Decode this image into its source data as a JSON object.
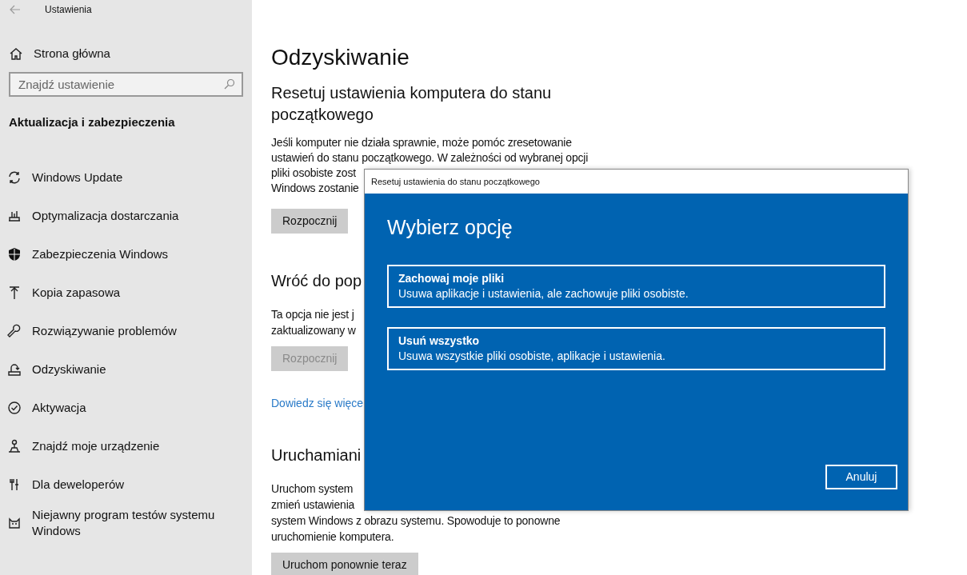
{
  "sidebar": {
    "app_title": "Ustawienia",
    "home": "Strona główna",
    "search": {
      "placeholder": "Znajdź ustawienie"
    },
    "section": "Aktualizacja i zabezpieczenia",
    "items": [
      {
        "label": "Windows Update",
        "selected": false
      },
      {
        "label": "Optymalizacja dostarczania",
        "selected": false
      },
      {
        "label": "Zabezpieczenia Windows",
        "selected": false
      },
      {
        "label": "Kopia zapasowa",
        "selected": false
      },
      {
        "label": "Rozwiązywanie problemów",
        "selected": false
      },
      {
        "label": "Odzyskiwanie",
        "selected": false
      },
      {
        "label": "Aktywacja",
        "selected": false
      },
      {
        "label": "Znajdź moje urządzenie",
        "selected": false
      },
      {
        "label": "Dla deweloperów",
        "selected": false
      },
      {
        "label": "Niejawny program testów systemu Windows",
        "selected": false
      }
    ]
  },
  "main": {
    "title": "Odzyskiwanie",
    "sections": [
      {
        "heading": [
          "Resetuj ustawienia komputera do stanu",
          "początkowego"
        ],
        "text": [
          "Jeśli komputer nie działa sprawnie, może pomóc zresetowanie",
          "ustawień do stanu początkowego. W zależności od wybranej opcji",
          "pliki osobiste zost",
          "Windows zostanie"
        ],
        "button": {
          "label": "Rozpocznij",
          "disabled": false
        }
      },
      {
        "heading": [
          "Wróć do pop"
        ],
        "text": [
          "Ta opcja nie jest j",
          "zaktualizowany w"
        ],
        "button": {
          "label": "Rozpocznij",
          "disabled": true
        },
        "link": "Dowiedz się więce"
      },
      {
        "heading": [
          "Uruchamiani"
        ],
        "text": [
          "Uruchom system",
          "zmień ustawienia",
          "system Windows z obrazu systemu. Spowoduje to ponowne",
          "uruchomienie komputera."
        ],
        "button": {
          "label": "Uruchom ponownie teraz",
          "disabled": false
        }
      }
    ]
  },
  "dialog": {
    "title": "Resetuj ustawienia do stanu początkowego",
    "heading": "Wybierz opcję",
    "options": [
      {
        "title": "Zachowaj moje pliki",
        "description": "Usuwa aplikacje i ustawienia, ale zachowuje pliki osobiste."
      },
      {
        "title": "Usuń wszystko",
        "description": "Usuwa wszystkie pliki osobiste, aplikacje i ustawienia."
      }
    ],
    "cancel": "Anuluj"
  }
}
